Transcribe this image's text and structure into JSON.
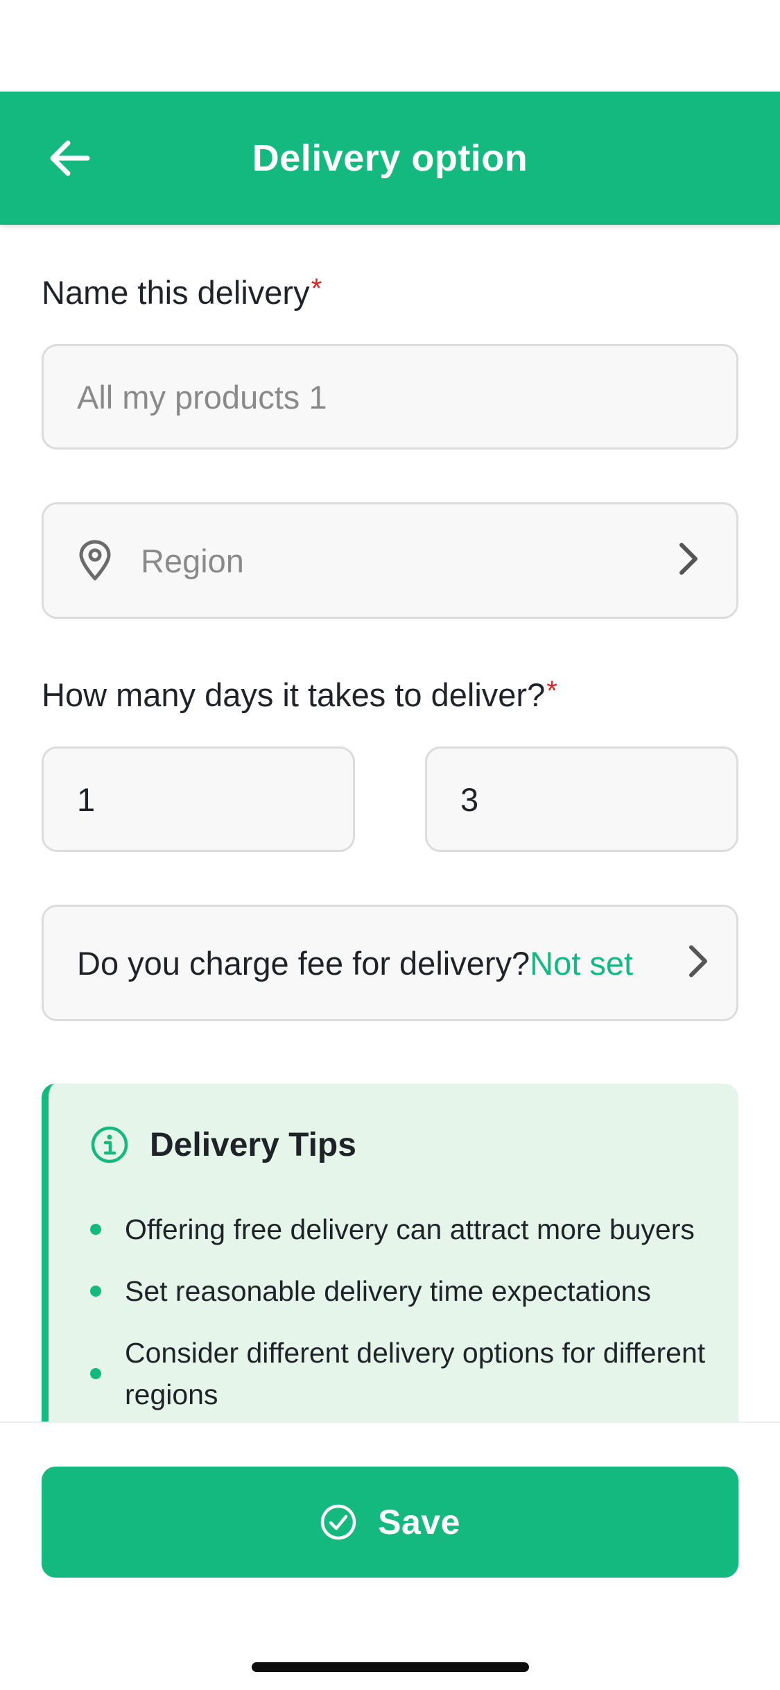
{
  "header": {
    "title": "Delivery option",
    "back_icon": "arrow-left-icon"
  },
  "form": {
    "name_label": "Name this delivery",
    "required_mark": "*",
    "name_value": "All my products 1",
    "region": {
      "icon": "location-pin-icon",
      "placeholder": "Region",
      "chevron": "chevron-right-icon"
    },
    "days_label": "How many days it takes to deliver?",
    "days_min": "1",
    "days_max": "3",
    "fee": {
      "question": "Do you charge fee for delivery?",
      "status": "Not set",
      "chevron": "chevron-right-icon"
    }
  },
  "tips": {
    "icon": "info-icon",
    "title": "Delivery Tips",
    "items": [
      "Offering free delivery can attract more buyers",
      "Set reasonable delivery time expectations",
      "Consider different delivery options for different regions"
    ]
  },
  "footer": {
    "save_icon": "check-circle-icon",
    "save_label": "Save"
  },
  "colors": {
    "brand": "#14b97f",
    "required": "#e02424",
    "tips_bg": "#e6f5ea",
    "field_bg": "#f8f8f8"
  }
}
